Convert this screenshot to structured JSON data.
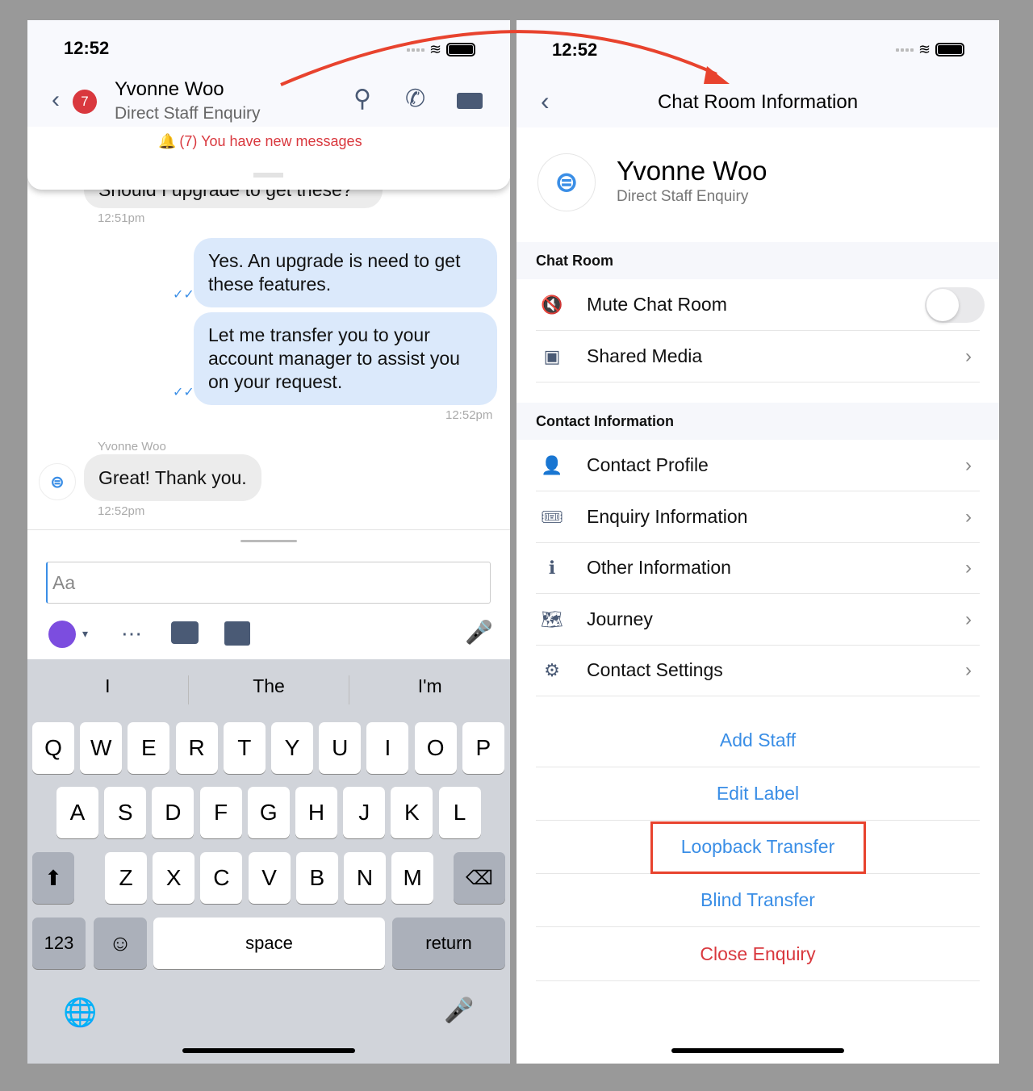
{
  "status_time": "12:52",
  "chat": {
    "unread_badge": "7",
    "title": "Yvonne Woo",
    "subtitle": "Direct Staff Enquiry",
    "notice": "(7) You have new messages",
    "messages": [
      {
        "text": "Should I upgrade to get these?",
        "time": "12:51pm",
        "direction": "in"
      },
      {
        "text": "Yes. An upgrade is need to get these features.",
        "direction": "out"
      },
      {
        "text": "Let me transfer you to your account manager to assist you on your request.",
        "time": "12:52pm",
        "direction": "out"
      },
      {
        "sender": "Yvonne Woo",
        "text": "Great! Thank you.",
        "time": "12:52pm",
        "direction": "in"
      }
    ],
    "input_value": "Aa",
    "suggestions": [
      "I",
      "The",
      "I'm"
    ],
    "keys_row1": [
      "Q",
      "W",
      "E",
      "R",
      "T",
      "Y",
      "U",
      "I",
      "O",
      "P"
    ],
    "keys_row2": [
      "A",
      "S",
      "D",
      "F",
      "G",
      "H",
      "J",
      "K",
      "L"
    ],
    "keys_row3": [
      "Z",
      "X",
      "C",
      "V",
      "B",
      "N",
      "M"
    ],
    "key_123": "123",
    "key_space": "space",
    "key_return": "return"
  },
  "info": {
    "title": "Chat Room Information",
    "name": "Yvonne Woo",
    "subtitle": "Direct Staff Enquiry",
    "section_chat_room": "Chat Room",
    "mute_label": "Mute Chat Room",
    "mute_on": false,
    "shared_media": "Shared Media",
    "section_contact": "Contact Information",
    "contact_items": [
      "Contact Profile",
      "Enquiry Information",
      "Other Information",
      "Journey",
      "Contact Settings"
    ],
    "actions": [
      "Add Staff",
      "Edit Label",
      "Loopback Transfer",
      "Blind Transfer",
      "Close Enquiry"
    ],
    "highlighted_action": "Loopback Transfer"
  },
  "colors": {
    "accent": "#3a8ee6",
    "danger": "#d9383e",
    "annotation": "#e8432e",
    "bubble_out": "#dbe9fb"
  }
}
